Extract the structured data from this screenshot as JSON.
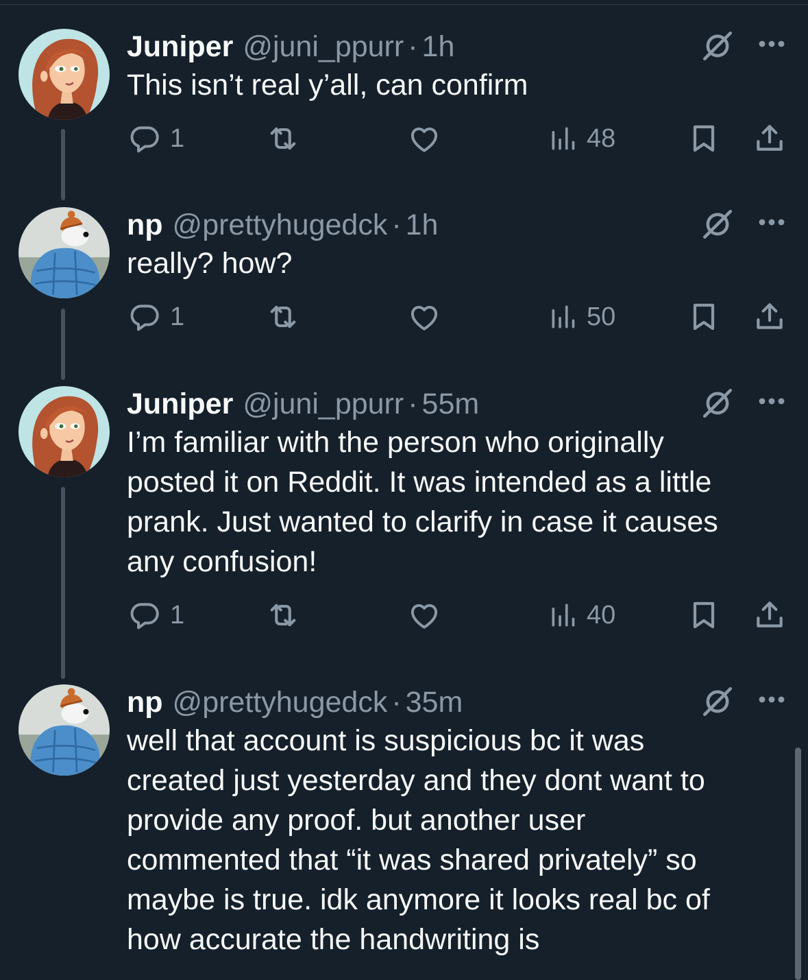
{
  "tweets": [
    {
      "name": "Juniper",
      "handle": "@juni_ppurr",
      "time": "1h",
      "text": "This isn’t real y’all, can confirm",
      "replies": "1",
      "retweets": "",
      "likes": "",
      "views": "48",
      "avatar": "cartoon-redhead-avatar"
    },
    {
      "name": "np",
      "handle": "@prettyhugedck",
      "time": "1h",
      "text": "really? how?",
      "replies": "1",
      "retweets": "",
      "likes": "",
      "views": "50",
      "avatar": "puffer-jacket-dog-avatar"
    },
    {
      "name": "Juniper",
      "handle": "@juni_ppurr",
      "time": "55m",
      "text": "I’m familiar with the person who originally\nposted it on Reddit. It was intended as a little\nprank. Just wanted to clarify in case it causes\nany confusion!",
      "replies": "1",
      "retweets": "",
      "likes": "",
      "views": "40",
      "avatar": "cartoon-redhead-avatar"
    },
    {
      "name": "np",
      "handle": "@prettyhugedck",
      "time": "35m",
      "text": "well that account is suspicious bc it was\ncreated just yesterday and they dont want to\nprovide any proof. but another user\ncommented that “it was shared privately” so\nmaybe is true. idk anymore it looks real bc of\nhow accurate the handwriting is",
      "avatar": "puffer-jacket-dog-avatar"
    }
  ],
  "separator": "·",
  "icons": {
    "reply": "reply-icon",
    "retweet": "retweet-icon",
    "like": "heart-icon",
    "views": "views-icon",
    "bookmark": "bookmark-icon",
    "share": "share-icon",
    "grok": "grok-icon",
    "more": "more-icon"
  },
  "colors": {
    "background": "#15202b",
    "text": "#f7f9f9",
    "secondary": "#8b98a5",
    "thread_line": "#425260"
  }
}
